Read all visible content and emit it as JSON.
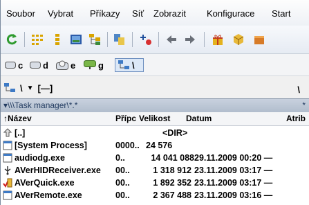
{
  "menu": [
    "Soubor",
    "Vybrat",
    "Příkazy",
    "Síť",
    "Zobrazit",
    "Konfigurace",
    "Start"
  ],
  "toolbar_icons": [
    "refresh-icon",
    "brief-view-icon",
    "detailed-view-icon",
    "thumbnail-view-icon",
    "tree-view-icon",
    "compare-icon",
    "pack-icon",
    "back-icon",
    "forward-icon",
    "gift-icon",
    "cube-icon"
  ],
  "drives": [
    {
      "letter": "c",
      "icon": "drive-icon"
    },
    {
      "letter": "d",
      "icon": "drive-icon"
    },
    {
      "letter": "e",
      "icon": "user-drive-icon"
    },
    {
      "letter": "g",
      "icon": "network-drive-icon"
    },
    {
      "letter": "\\",
      "icon": "network-icon",
      "active": true
    }
  ],
  "path_combo": {
    "value": "\\",
    "separator": "[—]"
  },
  "path_right": "\\",
  "tab": {
    "title": "▾\\\\\\Task manager\\*.*",
    "star": "*"
  },
  "columns": {
    "name": "↑Název",
    "pid": "Přípc",
    "size": "Velikost",
    "date": "Datum",
    "attr": "Atrib"
  },
  "files": [
    {
      "icon": "up-folder-icon",
      "name": "[..]",
      "pid": "",
      "size": "",
      "date": "",
      "dir": "<DIR>"
    },
    {
      "icon": "process-icon",
      "name": "[System Process]",
      "pid": "0000..",
      "size": "24 576",
      "date": "",
      "dir": ""
    },
    {
      "icon": "process-icon",
      "name": "audiodg.exe",
      "pid": "0..",
      "size": "14 041 088",
      "date": "29.11.2009 00:20 —",
      "dir": ""
    },
    {
      "icon": "usb-icon",
      "name": "AVerHIDReceiver.exe",
      "pid": "00..",
      "size": "1 318 912",
      "date": "23.11.2009 03:17 —",
      "dir": ""
    },
    {
      "icon": "averquick-icon",
      "name": "AVerQuick.exe",
      "pid": "00..",
      "size": "1 892 352",
      "date": "23.11.2009 03:17 —",
      "dir": ""
    },
    {
      "icon": "process-icon",
      "name": "AVerRemote.exe",
      "pid": "00..",
      "size": "2 367 488",
      "date": "23.11.2009 03:16 —",
      "dir": ""
    }
  ],
  "colors": {
    "tab_bg": "#b9c4d4",
    "accent": "#233c61"
  }
}
